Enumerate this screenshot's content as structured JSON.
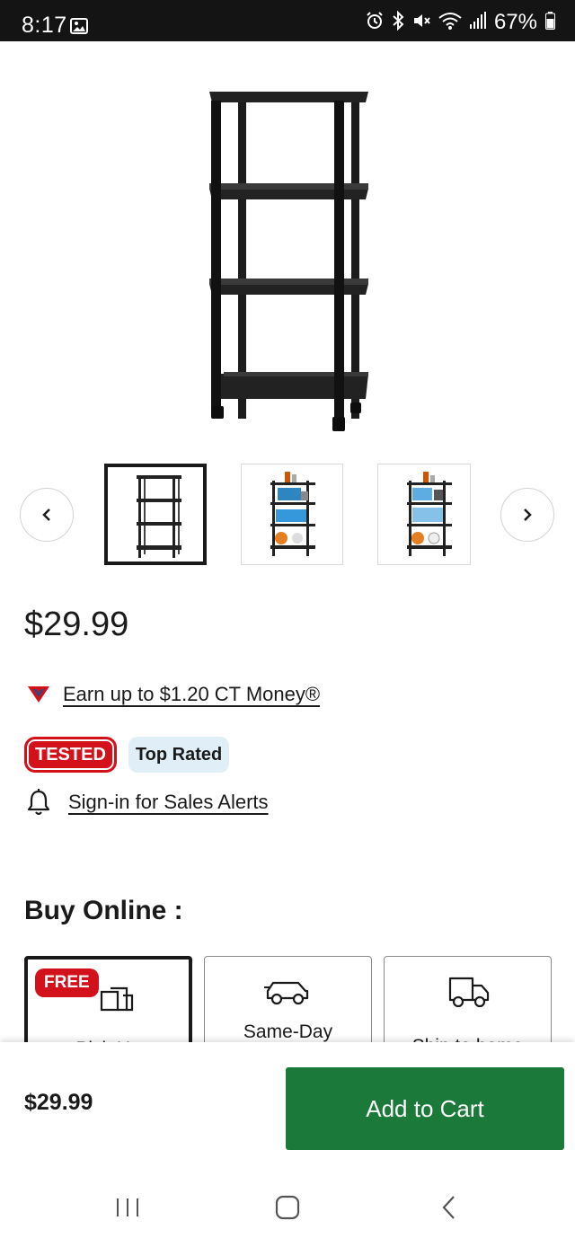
{
  "status_bar": {
    "time": "8:17",
    "battery": "67%",
    "icons": [
      "gallery-icon",
      "alarm-icon",
      "bluetooth-icon",
      "mute-icon",
      "wifi-icon",
      "signal-icon",
      "battery-icon"
    ]
  },
  "product": {
    "price": "$29.99",
    "ct_money_text": "Earn up to $1.20 CT Money®",
    "badges": {
      "tested": "TESTED",
      "top_rated": "Top Rated"
    },
    "sales_alert_text": "Sign-in for Sales Alerts"
  },
  "gallery": {
    "selected_index": 0,
    "thumbnails": [
      "shelf-empty",
      "shelf-with-items",
      "shelf-with-items-alt"
    ]
  },
  "buy_online": {
    "title": "Buy Online :",
    "options": [
      {
        "label": "Pick Up",
        "badge": "FREE",
        "icon": "pickup-icon",
        "selected": true
      },
      {
        "label": "Same-Day",
        "icon": "car-icon",
        "selected": false
      },
      {
        "label": "Ship to home",
        "icon": "truck-icon",
        "selected": false
      }
    ]
  },
  "bottom_bar": {
    "price": "$29.99",
    "add_to_cart": "Add to Cart"
  },
  "colors": {
    "accent_red": "#d2111b",
    "cart_green": "#1b7a3a",
    "top_rated_bg": "#e0eef7"
  }
}
